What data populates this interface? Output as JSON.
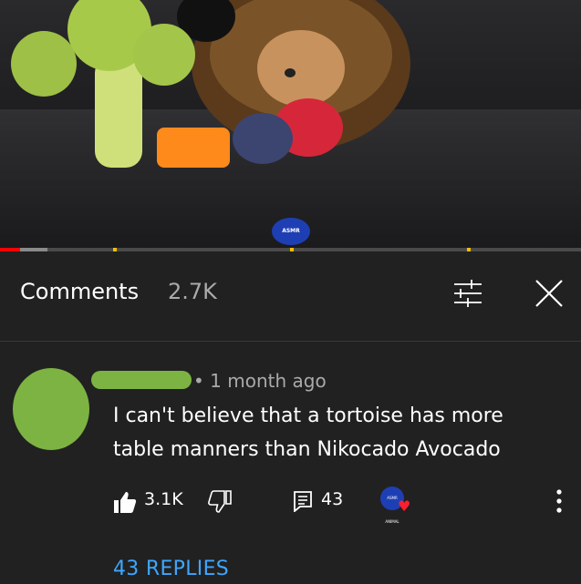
{
  "video": {
    "channel_watermark": "ASMR ANIMAL",
    "progress_fraction": 0.035
  },
  "comments_panel": {
    "title": "Comments",
    "count": "2.7K",
    "filter_icon": "sliders-icon",
    "close_icon": "close-icon"
  },
  "comment": {
    "timestamp": "• 1 month ago",
    "text": "I can't believe that a tortoise has more table manners than Nikocado Avocado",
    "like_count": "3.1K",
    "reply_count": "43",
    "creator_avatar_label": "ASMR ANIMAL",
    "replies_link": "43 REPLIES"
  },
  "colors": {
    "background": "#212121",
    "link": "#3ea6ff",
    "avatar_redaction": "#7cb342",
    "heart": "#ff1e2d"
  }
}
